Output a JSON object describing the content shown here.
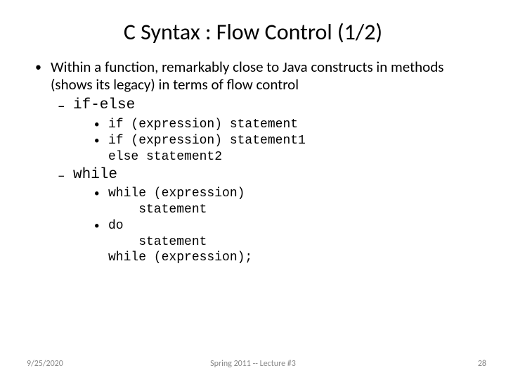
{
  "title": "C Syntax : Flow Control (1/2)",
  "main_bullet": "Within a function, remarkably close to Java constructs in methods (shows its legacy) in terms of flow control",
  "sections": {
    "ifelse": {
      "label": "if-else",
      "item1": "if (expression) statement",
      "item2": "if (expression) statement1\nelse statement2"
    },
    "while": {
      "label": "while",
      "item1": "while (expression)\n    statement",
      "item2": "do\n    statement\nwhile (expression);"
    }
  },
  "footer": {
    "date": "9/25/2020",
    "course": "Spring 2011 -- Lecture #3",
    "page": "28"
  }
}
